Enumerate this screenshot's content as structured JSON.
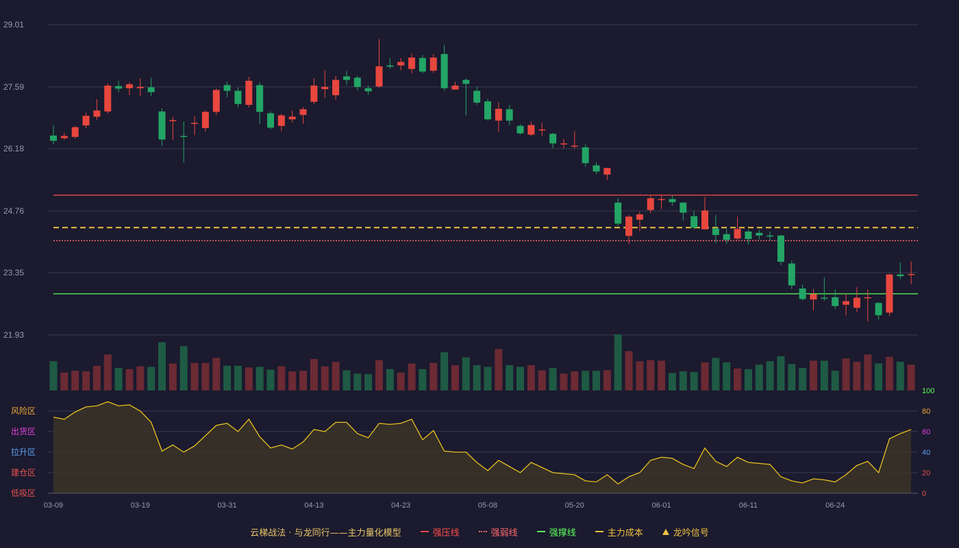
{
  "chart_data": {
    "type": "candlestick",
    "price_axis": {
      "min": 21.93,
      "max": 29.01,
      "ticks": [
        "29.01",
        "27.59",
        "26.18",
        "24.76",
        "23.35",
        "21.93"
      ]
    },
    "x_tick_labels": [
      {
        "index": 0,
        "label": "03-09"
      },
      {
        "index": 8,
        "label": "03-19"
      },
      {
        "index": 16,
        "label": "03-31"
      },
      {
        "index": 24,
        "label": "04-13"
      },
      {
        "index": 32,
        "label": "04-23"
      },
      {
        "index": 40,
        "label": "05-08"
      },
      {
        "index": 48,
        "label": "05-20"
      },
      {
        "index": 56,
        "label": "06-01"
      },
      {
        "index": 64,
        "label": "06-11"
      },
      {
        "index": 72,
        "label": "06-24"
      }
    ],
    "candles": [
      [
        26.48,
        26.36,
        26.72,
        26.28
      ],
      [
        26.42,
        26.47,
        26.54,
        26.38
      ],
      [
        26.45,
        26.67,
        26.7,
        26.41
      ],
      [
        26.71,
        26.93,
        27.0,
        26.64
      ],
      [
        26.91,
        27.05,
        27.31,
        26.84
      ],
      [
        27.03,
        27.62,
        27.67,
        26.98
      ],
      [
        27.61,
        27.55,
        27.73,
        27.47
      ],
      [
        27.56,
        27.65,
        27.7,
        27.4
      ],
      [
        27.56,
        27.59,
        27.79,
        27.38
      ],
      [
        27.58,
        27.47,
        27.8,
        27.38
      ],
      [
        27.03,
        26.39,
        27.1,
        26.24
      ],
      [
        26.82,
        26.83,
        26.91,
        26.38
      ],
      [
        26.47,
        26.46,
        26.8,
        25.86
      ],
      [
        26.76,
        26.77,
        26.93,
        26.49
      ],
      [
        26.65,
        27.02,
        27.05,
        26.57
      ],
      [
        27.02,
        27.52,
        27.55,
        26.95
      ],
      [
        27.63,
        27.5,
        27.71,
        27.35
      ],
      [
        27.5,
        27.2,
        27.58,
        27.13
      ],
      [
        27.18,
        27.73,
        27.82,
        27.12
      ],
      [
        27.63,
        27.02,
        27.7,
        26.74
      ],
      [
        26.99,
        26.66,
        27.03,
        26.62
      ],
      [
        26.7,
        26.94,
        26.98,
        26.58
      ],
      [
        26.85,
        26.91,
        27.05,
        26.78
      ],
      [
        26.95,
        27.08,
        27.13,
        26.75
      ],
      [
        27.25,
        27.62,
        27.79,
        27.2
      ],
      [
        27.54,
        27.59,
        27.97,
        27.34
      ],
      [
        27.4,
        27.75,
        27.84,
        27.3
      ],
      [
        27.83,
        27.75,
        27.95,
        27.64
      ],
      [
        27.8,
        27.59,
        27.84,
        27.51
      ],
      [
        27.56,
        27.49,
        27.62,
        27.41
      ],
      [
        27.6,
        28.06,
        28.68,
        27.57
      ],
      [
        28.08,
        28.05,
        28.25,
        28.0
      ],
      [
        28.08,
        28.16,
        28.25,
        27.97
      ],
      [
        28.0,
        28.26,
        28.35,
        27.9
      ],
      [
        28.25,
        27.94,
        28.32,
        27.9
      ],
      [
        27.96,
        28.26,
        28.34,
        27.91
      ],
      [
        28.34,
        27.56,
        28.55,
        27.5
      ],
      [
        27.53,
        27.62,
        27.71,
        27.53
      ],
      [
        27.75,
        27.66,
        27.78,
        26.94
      ],
      [
        27.5,
        27.23,
        27.6,
        27.18
      ],
      [
        27.26,
        26.85,
        27.32,
        26.82
      ],
      [
        26.82,
        27.09,
        27.24,
        26.56
      ],
      [
        27.08,
        26.82,
        27.18,
        26.72
      ],
      [
        26.7,
        26.53,
        26.74,
        26.5
      ],
      [
        26.5,
        26.72,
        26.8,
        26.47
      ],
      [
        26.62,
        26.62,
        26.77,
        26.47
      ],
      [
        26.52,
        26.3,
        26.54,
        26.19
      ],
      [
        26.3,
        26.3,
        26.4,
        26.19
      ],
      [
        26.23,
        26.25,
        26.58,
        26.19
      ],
      [
        26.21,
        25.85,
        26.28,
        25.77
      ],
      [
        25.8,
        25.66,
        25.87,
        25.6
      ],
      [
        25.59,
        25.74,
        25.74,
        25.47
      ],
      [
        24.95,
        24.47,
        25.05,
        24.41
      ],
      [
        24.19,
        24.63,
        24.67,
        24.0
      ],
      [
        24.56,
        24.68,
        24.74,
        24.3
      ],
      [
        24.78,
        25.05,
        25.12,
        24.71
      ],
      [
        25.02,
        25.03,
        25.14,
        24.8
      ],
      [
        25.03,
        24.96,
        25.12,
        24.88
      ],
      [
        24.95,
        24.72,
        24.96,
        24.54
      ],
      [
        24.64,
        24.38,
        24.76,
        24.34
      ],
      [
        24.34,
        24.77,
        25.08,
        24.34
      ],
      [
        24.36,
        24.21,
        24.67,
        24.02
      ],
      [
        24.23,
        24.1,
        24.35,
        24.01
      ],
      [
        24.13,
        24.35,
        24.63,
        24.1
      ],
      [
        24.29,
        24.12,
        24.33,
        23.99
      ],
      [
        24.26,
        24.2,
        24.33,
        24.11
      ],
      [
        24.2,
        24.18,
        24.29,
        24.08
      ],
      [
        24.2,
        23.6,
        24.21,
        23.52
      ],
      [
        23.56,
        23.06,
        23.63,
        22.98
      ],
      [
        22.99,
        22.75,
        23.08,
        22.72
      ],
      [
        22.74,
        22.86,
        22.98,
        22.49
      ],
      [
        22.78,
        22.77,
        23.24,
        22.71
      ],
      [
        22.79,
        22.59,
        22.97,
        22.52
      ],
      [
        22.62,
        22.7,
        22.87,
        22.38
      ],
      [
        22.55,
        22.78,
        23.02,
        22.45
      ],
      [
        22.79,
        22.79,
        22.97,
        22.24
      ],
      [
        22.66,
        22.38,
        22.68,
        22.28
      ],
      [
        22.44,
        23.31,
        23.33,
        22.36
      ],
      [
        23.31,
        23.27,
        23.59,
        23.2
      ],
      [
        23.32,
        23.32,
        23.61,
        23.09
      ]
    ],
    "volume_levels": [
      0.52,
      0.32,
      0.35,
      0.34,
      0.44,
      0.64,
      0.4,
      0.38,
      0.43,
      0.42,
      0.86,
      0.48,
      0.79,
      0.49,
      0.49,
      0.58,
      0.44,
      0.44,
      0.41,
      0.42,
      0.37,
      0.43,
      0.34,
      0.35,
      0.56,
      0.43,
      0.51,
      0.36,
      0.3,
      0.29,
      0.54,
      0.38,
      0.32,
      0.48,
      0.38,
      0.49,
      0.68,
      0.45,
      0.59,
      0.45,
      0.42,
      0.74,
      0.45,
      0.42,
      0.45,
      0.36,
      0.4,
      0.3,
      0.34,
      0.35,
      0.35,
      0.36,
      1.0,
      0.7,
      0.52,
      0.54,
      0.53,
      0.31,
      0.34,
      0.33,
      0.5,
      0.58,
      0.5,
      0.39,
      0.38,
      0.46,
      0.52,
      0.61,
      0.47,
      0.4,
      0.53,
      0.53,
      0.35,
      0.57,
      0.51,
      0.64,
      0.48,
      0.6,
      0.51,
      0.46
    ],
    "lines": {
      "strong_pressure": 25.12,
      "main_cost": 24.38,
      "strong_weak": 24.08,
      "strong_support": 22.87
    },
    "indicator": {
      "ylim": [
        0,
        100
      ],
      "right_ticks": [
        "100",
        "80",
        "60",
        "40",
        "20",
        "0"
      ],
      "zones": [
        {
          "label": "风险区",
          "color": "#e8a838"
        },
        {
          "label": "出货区",
          "color": "#e040e0"
        },
        {
          "label": "拉升区",
          "color": "#5aa0f0"
        },
        {
          "label": "建仓区",
          "color": "#e85050"
        },
        {
          "label": "低吸区",
          "color": "#e85050"
        }
      ],
      "values": [
        74,
        72,
        79,
        84,
        85,
        89,
        85,
        86,
        80,
        69,
        41,
        47,
        40,
        46,
        56,
        66,
        68,
        60,
        72,
        55,
        44,
        47,
        43,
        50,
        62,
        60,
        69,
        69,
        58,
        54,
        68,
        67,
        68,
        72,
        52,
        61,
        41,
        40,
        40,
        30,
        22,
        32,
        26,
        20,
        30,
        25,
        20,
        19,
        18,
        12,
        11,
        18,
        9,
        16,
        20,
        32,
        35,
        34,
        28,
        24,
        44,
        31,
        26,
        35,
        30,
        29,
        28,
        16,
        12,
        10,
        14,
        13,
        11,
        18,
        27,
        31,
        20,
        53,
        58,
        62
      ]
    },
    "colors": {
      "up": "#e8473e",
      "down": "#23a566",
      "grid": "#3a3c52",
      "bg": "#1b1a2e"
    }
  },
  "legend": {
    "title": "云梯战法 · 与龙同行——主力量化模型",
    "items": [
      {
        "label": "强压线",
        "color": "#ff4d4d",
        "style": "solid"
      },
      {
        "label": "强弱线",
        "color": "#ff6b6b",
        "style": "dotted"
      },
      {
        "label": "强撑线",
        "color": "#5cff5c",
        "style": "solid"
      },
      {
        "label": "主力成本",
        "color": "#f0c040",
        "style": "dashed"
      },
      {
        "label": "龙吟信号",
        "color": "#f0c040",
        "style": "triangle"
      }
    ]
  }
}
